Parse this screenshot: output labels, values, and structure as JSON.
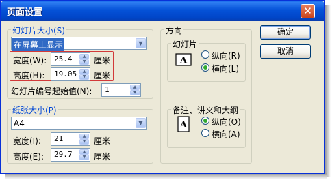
{
  "window": {
    "title": "页面设置",
    "close_glyph": "✕"
  },
  "slide_size": {
    "group_label": "幻灯片大小(S)",
    "selected": "在屏幕上显示",
    "width_label": "宽度(W):",
    "width_value": "25.4",
    "width_unit": "厘米",
    "height_label": "高度(H):",
    "height_value": "19.05",
    "height_unit": "厘米",
    "numbering_label": "幻灯片编号起始值(N):",
    "numbering_value": "1"
  },
  "paper_size": {
    "group_label": "纸张大小(P)",
    "selected": "A4",
    "width_label": "宽度(I):",
    "width_value": "21",
    "width_unit": "厘米",
    "height_label": "高度(E):",
    "height_value": "29.7",
    "height_unit": "厘米"
  },
  "orientation": {
    "group_label": "方向",
    "slides": {
      "label": "幻灯片",
      "portrait_label": "纵向(R)",
      "landscape_label": "横向(L)",
      "selected": "landscape"
    },
    "notes": {
      "label": "备注、讲义和大纲",
      "portrait_label": "纵向(O)",
      "landscape_label": "横向(A)",
      "selected": "portrait"
    }
  },
  "buttons": {
    "ok_label": "确定",
    "cancel_label": "取消"
  },
  "icons": {
    "page_glyph": "A"
  },
  "colors": {
    "titlebar": "#0553d9",
    "highlight": "#d23a3a",
    "selection": "#316ac5",
    "group_label": "#0046d5"
  }
}
